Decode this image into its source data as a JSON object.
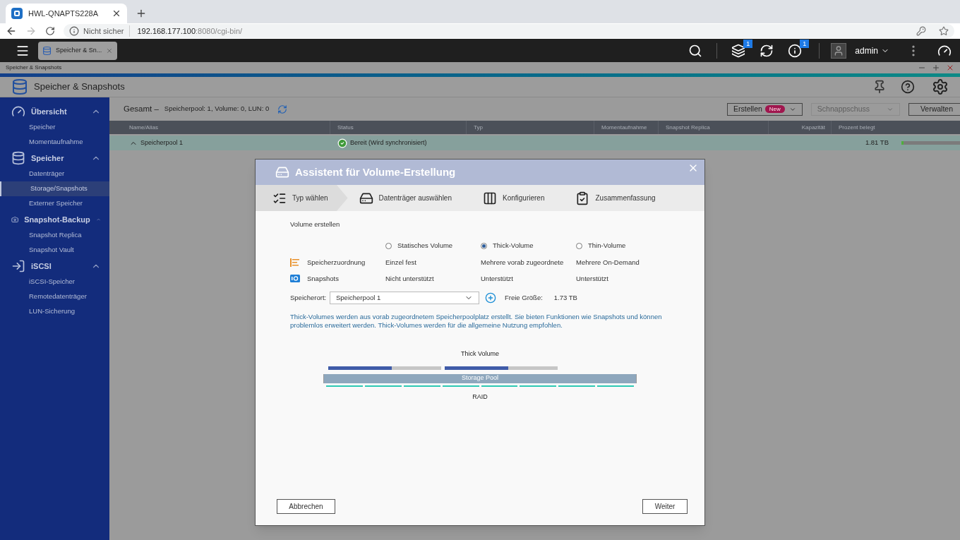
{
  "browser": {
    "tab_title": "HWL-QNAPTS228A",
    "security": "Nicht sicher",
    "url_host": "192.168.177.100",
    "url_rest": ":8080/cgi-bin/"
  },
  "topbar": {
    "app_tab": "Speicher & Sn...",
    "tasks_badge": "1",
    "info_badge": "1",
    "user": "admin"
  },
  "window_strip": {
    "title": "Speicher & Snapshots"
  },
  "app_header": {
    "title": "Speicher & Snapshots"
  },
  "sidebar": {
    "groups": [
      {
        "label": "Übersicht",
        "kind": "overview",
        "expanded": true,
        "children": [
          {
            "label": "Speicher",
            "selected": false
          },
          {
            "label": "Momentaufnahme",
            "selected": false
          }
        ]
      },
      {
        "label": "Speicher",
        "kind": "storage",
        "expanded": true,
        "children": [
          {
            "label": "Datenträger",
            "selected": false
          },
          {
            "label": "Storage/Snapshots",
            "selected": true
          },
          {
            "label": "Externer Speicher",
            "selected": false
          }
        ]
      },
      {
        "label": "Snapshot-Backup",
        "kind": "snapshot",
        "expanded": true,
        "children": [
          {
            "label": "Snapshot Replica",
            "selected": false
          },
          {
            "label": "Snapshot Vault",
            "selected": false
          }
        ]
      },
      {
        "label": "iSCSI",
        "kind": "iscsi",
        "expanded": true,
        "children": [
          {
            "label": "iSCSI-Speicher",
            "selected": false
          },
          {
            "label": "Remotedatenträger",
            "selected": false
          },
          {
            "label": "LUN-Sicherung",
            "selected": false
          }
        ]
      }
    ]
  },
  "summary": {
    "label": "Gesamt –",
    "details": "Speicherpool: 1, Volume: 0, LUN: 0"
  },
  "toolbar": [
    {
      "label": "Erstellen",
      "badge": "New",
      "dropdown": true,
      "disabled": false
    },
    {
      "label": "Schnappschuss",
      "dropdown": true,
      "disabled": true
    },
    {
      "label": "Verwalten",
      "dropdown": false,
      "disabled": false
    }
  ],
  "table": {
    "columns": [
      "Name/Alias",
      "Status",
      "Typ",
      "Momentaufnahme",
      "Snapshot Replica",
      "Kapazität",
      "Prozent belegt"
    ],
    "rows": [
      {
        "name": "Speicherpool 1",
        "expanded": true,
        "status": "Bereit (Wird synchronisiert)",
        "capacity": "1.81 TB",
        "level": 0.03
      }
    ]
  },
  "dialog": {
    "title": "Assistent für Volume-Erstellung",
    "steps": [
      {
        "label": "Typ wählen",
        "kind": "type",
        "selected": true
      },
      {
        "label": "Datenträger auswählen",
        "kind": "disk",
        "selected": false
      },
      {
        "label": "Konfigurieren",
        "kind": "config",
        "selected": false
      },
      {
        "label": "Zusammenfassung",
        "kind": "summary",
        "selected": false
      }
    ],
    "section": "Volume erstellen",
    "options": [
      {
        "label": "Statisches Volume",
        "selected": false
      },
      {
        "label": "Thick-Volume",
        "selected": true
      },
      {
        "label": "Thin-Volume",
        "selected": false
      }
    ],
    "features": [
      {
        "label": "Speicherzuordnung",
        "kind": "allocation",
        "values": [
          "Einzel fest",
          "Mehrere vorab zugeordnete",
          "Mehrere On-Demand"
        ]
      },
      {
        "label": "Snapshots",
        "kind": "snapshots",
        "values": [
          "Nicht unterstützt",
          "Unterstützt",
          "Unterstützt"
        ]
      }
    ],
    "location_label": "Speicherort:",
    "location_value": "Speicherpool 1",
    "free_label": "Freie Größe:",
    "free_value": "1.73 TB",
    "description": "Thick-Volumes werden aus vorab zugeordnetem Speicherpoolplatz erstellt. Sie bieten Funktionen wie Snapshots und können problemlos erweitert werden. Thick-Volumes werden für die allgemeine Nutzung empfohlen.",
    "diagram": {
      "volume_label": "Thick Volume",
      "pool_label": "Storage Pool",
      "raid_label": "RAID"
    },
    "buttons": {
      "cancel": "Abbrechen",
      "next": "Weiter"
    }
  }
}
